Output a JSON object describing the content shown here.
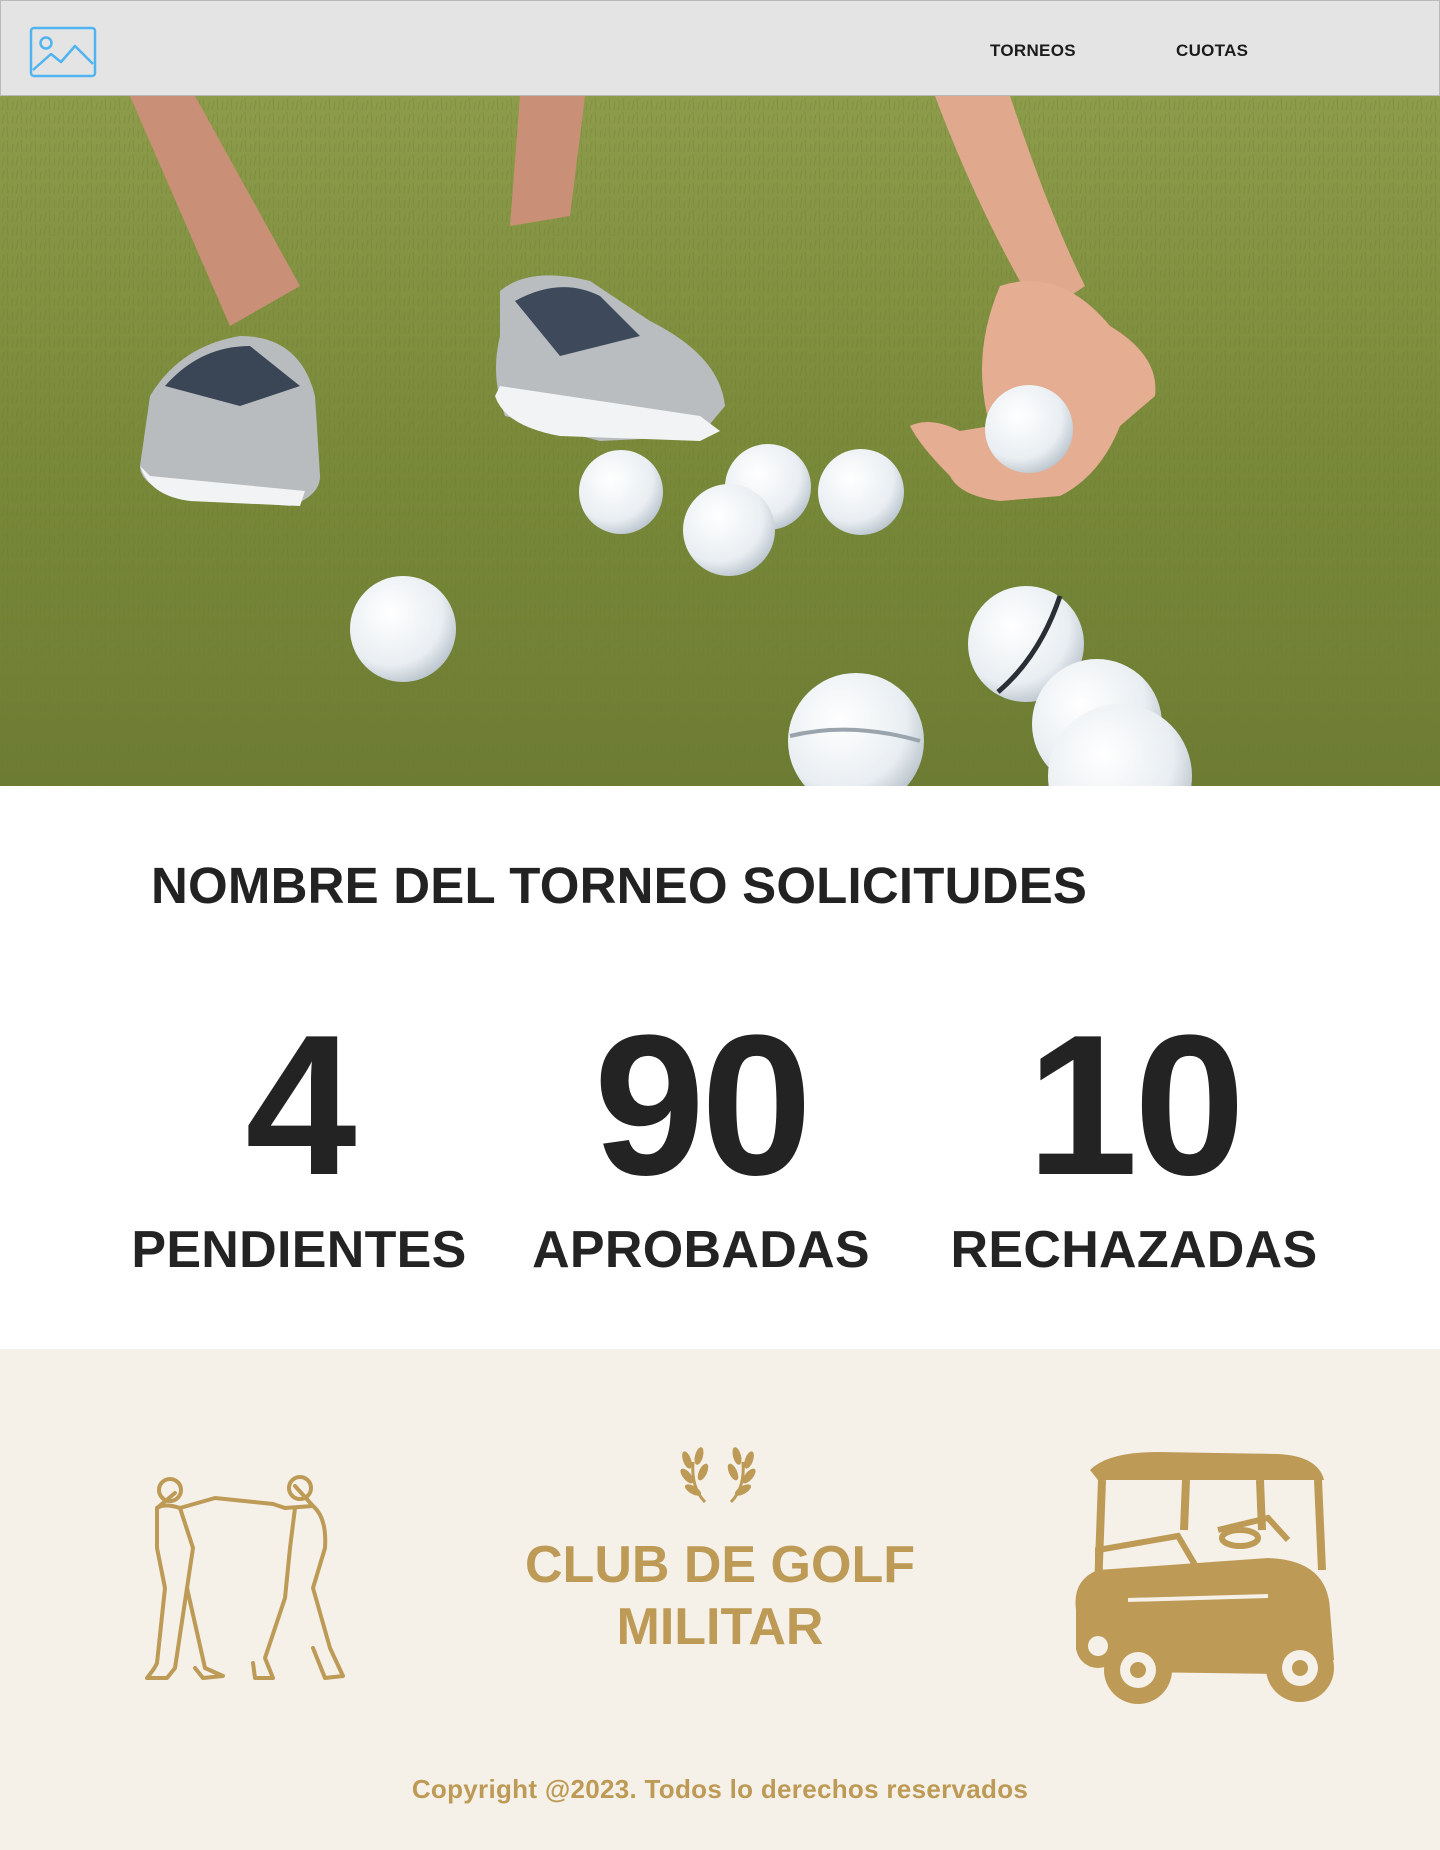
{
  "nav": {
    "logo_icon": "image-placeholder-icon",
    "links": [
      {
        "label": "TORNEOS"
      },
      {
        "label": "CUOTAS"
      }
    ]
  },
  "hero": {
    "image_icon": "golf-balls-on-grass-photo"
  },
  "main": {
    "title": "NOMBRE DEL TORNEO SOLICITUDES",
    "stats": [
      {
        "value": "4",
        "label": "PENDIENTES"
      },
      {
        "value": "90",
        "label": "APROBADAS"
      },
      {
        "value": "10",
        "label": "RECHAZADAS"
      }
    ]
  },
  "footer": {
    "club_name_line1": "CLUB DE GOLF",
    "club_name_line2": "MILITAR",
    "copyright": "Copyright @2023. Todos lo derechos reservados",
    "accent_color": "#bd9a55",
    "background_color": "#f5f0e8",
    "left_icon": "golfers-icon",
    "center_icon": "laurel-icon",
    "right_icon": "golf-cart-icon"
  }
}
